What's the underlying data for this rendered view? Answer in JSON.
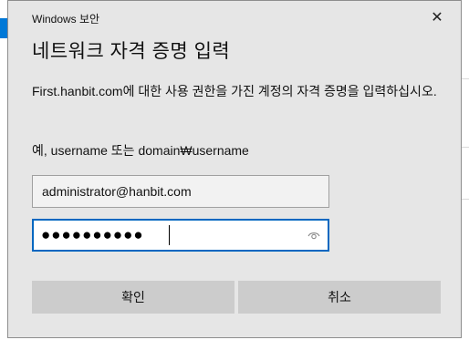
{
  "dialog": {
    "caption": "Windows 보안",
    "close_symbol": "✕",
    "title": "네트워크 자격 증명 입력",
    "message": "First.hanbit.com에 대한 사용 권한을 가진 계정의 자격 증명을 입력하십시오.",
    "example": "예, username 또는 domain₩username"
  },
  "username_field": {
    "value": "administrator@hanbit.com"
  },
  "password_field": {
    "masked_value": "●●●●●●●●●●",
    "reveal_icon": "eye-icon"
  },
  "buttons": {
    "ok_label": "확인",
    "cancel_label": "취소"
  },
  "colors": {
    "accent": "#0078d7",
    "focus_border": "#0067c0",
    "dialog_bg": "#e6e6e6",
    "button_bg": "#cccccc"
  }
}
